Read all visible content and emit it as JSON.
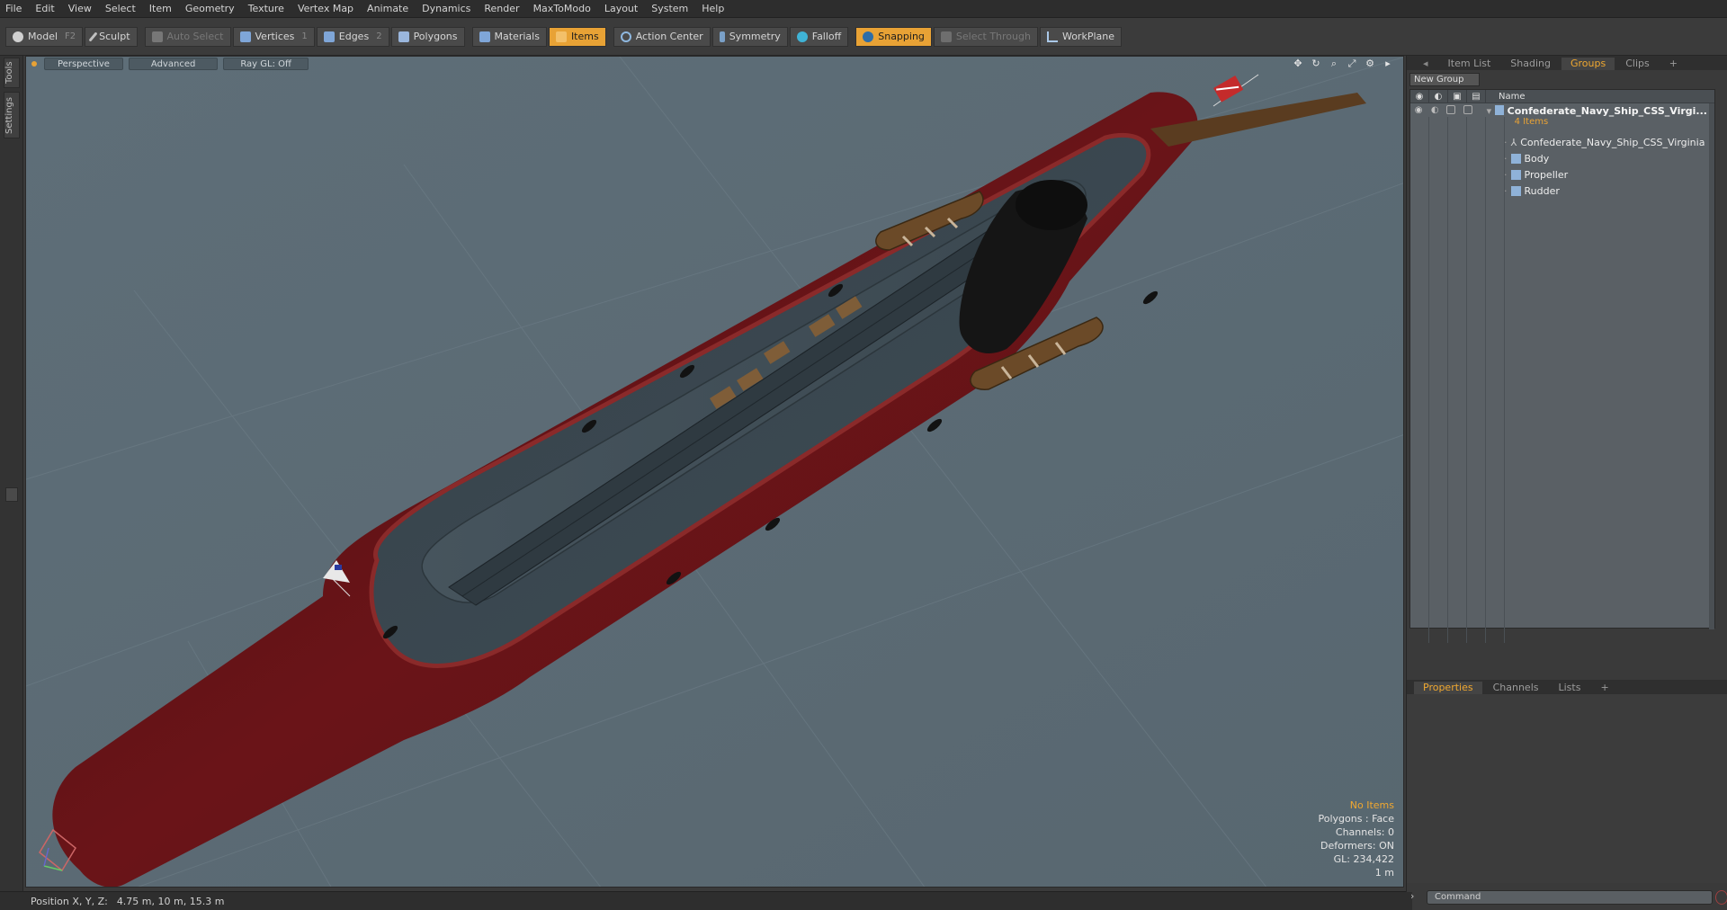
{
  "menu": [
    "File",
    "Edit",
    "View",
    "Select",
    "Item",
    "Geometry",
    "Texture",
    "Vertex Map",
    "Animate",
    "Dynamics",
    "Render",
    "MaxToModo",
    "Layout",
    "System",
    "Help"
  ],
  "toolbar": {
    "model": "Model",
    "model_key": "F2",
    "sculpt": "Sculpt",
    "auto_select": "Auto Select",
    "vertices": "Vertices",
    "vertices_key": "1",
    "edges": "Edges",
    "edges_key": "2",
    "polygons": "Polygons",
    "materials": "Materials",
    "items": "Items",
    "action_center": "Action Center",
    "symmetry": "Symmetry",
    "falloff": "Falloff",
    "snapping": "Snapping",
    "select_through": "Select Through",
    "workplane": "WorkPlane"
  },
  "left_tabs": {
    "tools": "Tools",
    "settings": "Settings"
  },
  "viewport": {
    "view": "Perspective",
    "shading": "Advanced",
    "raygl": "Ray GL: Off",
    "hud": {
      "selection": "No Items",
      "polygons": "Polygons : Face",
      "channels": "Channels: 0",
      "deformers": "Deformers: ON",
      "gl": "GL: 234,422",
      "scale": "1 m"
    }
  },
  "status": {
    "label": "Position X, Y, Z:",
    "value": "4.75 m, 10 m, 15.3 m"
  },
  "right_panel": {
    "tabs": [
      "Item List",
      "Shading",
      "Groups",
      "Clips"
    ],
    "active_tab": "Groups",
    "new_group": "New Group",
    "name_header": "Name",
    "group": {
      "name": "Confederate_Navy_Ship_CSS_Virgi...",
      "count": "4 Items"
    },
    "children": [
      "Confederate_Navy_Ship_CSS_Virginia",
      "Body",
      "Propeller",
      "Rudder"
    ],
    "bottom_tabs": [
      "Properties",
      "Channels",
      "Lists"
    ],
    "command_placeholder": "Command"
  },
  "colors": {
    "accent": "#e8a235",
    "viewport_bg": "#5b6b75",
    "hull_red": "#6e1414",
    "deck": "#3d4a52"
  }
}
